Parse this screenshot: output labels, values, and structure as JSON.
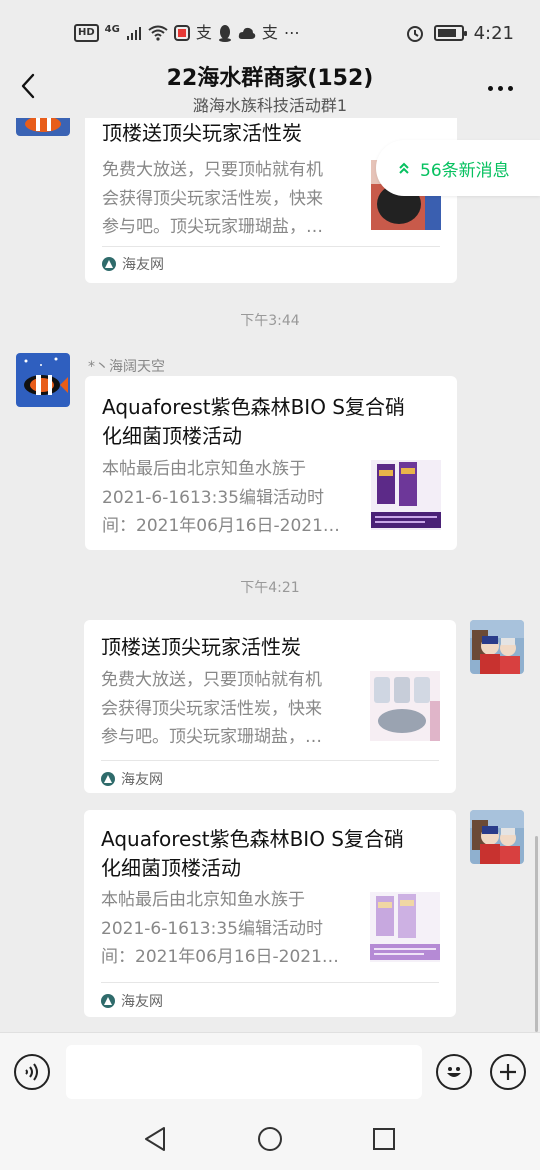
{
  "status_bar": {
    "hd": "HD",
    "network": "4G",
    "time": "4:21",
    "battery_level": 0.85
  },
  "header": {
    "title": "22海水群商家(152)",
    "subtitle": "潞海水族科技活动群1"
  },
  "new_messages": {
    "label": "56条新消息"
  },
  "messages": [
    {
      "title": "顶楼送顶尖玩家活性炭",
      "desc_lines": [
        "免费大放送，只要顶帖就有机",
        "会获得顶尖玩家活性炭，快来",
        "参与吧。顶尖玩家珊瑚盐，…"
      ],
      "source": "海友网"
    },
    {
      "timestamp": "下午3:44",
      "sender": "*丶海阔天空",
      "title_lines": [
        "Aquaforest紫色森林BIO S复合硝",
        "化细菌顶楼活动"
      ],
      "desc_lines": [
        "本帖最后由北京知鱼水族于",
        "2021-6-1613:35编辑活动时",
        "间：2021年06月16日-2021…"
      ]
    },
    {
      "timestamp": "下午4:21",
      "title": "顶楼送顶尖玩家活性炭",
      "desc_lines": [
        "免费大放送，只要顶帖就有机",
        "会获得顶尖玩家活性炭，快来",
        "参与吧。顶尖玩家珊瑚盐，…"
      ],
      "source": "海友网"
    },
    {
      "title_lines": [
        "Aquaforest紫色森林BIO S复合硝",
        "化细菌顶楼活动"
      ],
      "desc_lines": [
        "本帖最后由北京知鱼水族于",
        "2021-6-1613:35编辑活动时",
        "间：2021年06月16日-2021…"
      ],
      "source": "海友网"
    }
  ],
  "input": {
    "placeholder": ""
  },
  "icons": {
    "back": "back-arrow-icon",
    "more": "more-dots-icon",
    "voice": "voice-icon",
    "emoji": "emoji-icon",
    "plus": "plus-icon",
    "nav_back": "triangle-back-icon",
    "nav_home": "circle-home-icon",
    "nav_recent": "square-recent-icon"
  },
  "colors": {
    "accent_green": "#07c160",
    "background": "#ededed"
  }
}
